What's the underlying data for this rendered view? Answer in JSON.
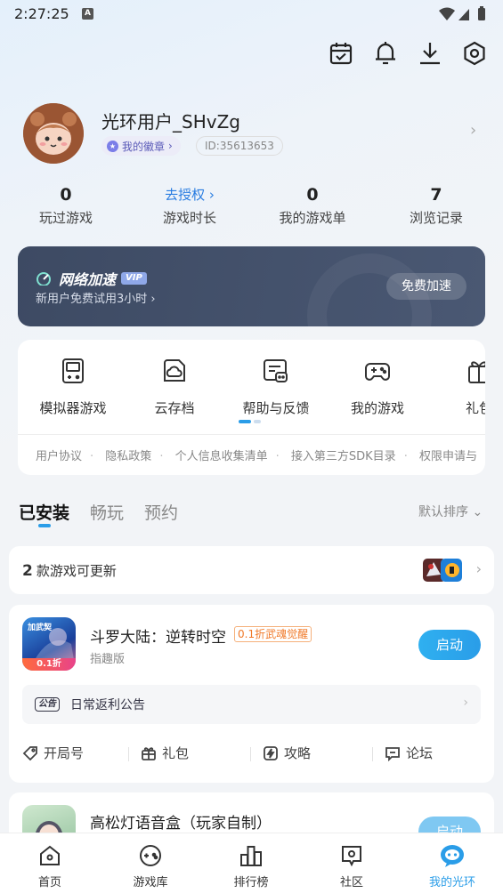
{
  "status_bar": {
    "time": "2:27:25",
    "a_icon": "A"
  },
  "top_actions": [
    {
      "icon": "calendar-check-icon"
    },
    {
      "icon": "bell-icon"
    },
    {
      "icon": "download-icon"
    },
    {
      "icon": "settings-hexagon-icon"
    }
  ],
  "profile": {
    "username": "光环用户_SHvZg",
    "badge_label": "我的徽章",
    "user_id": "ID:35613653"
  },
  "stats": [
    {
      "value": "0",
      "label": "玩过游戏"
    },
    {
      "value": "去授权",
      "label": "游戏时长"
    },
    {
      "value": "0",
      "label": "我的游戏单"
    },
    {
      "value": "7",
      "label": "浏览记录"
    }
  ],
  "accelerator": {
    "title": "网络加速",
    "vip": "VIP",
    "subtitle": "新用户免费试用3小时",
    "button": "免费加速"
  },
  "tools": [
    {
      "label": "模拟器游戏",
      "icon": "gameboy-icon"
    },
    {
      "label": "云存档",
      "icon": "cloud-save-icon"
    },
    {
      "label": "帮助与反馈",
      "icon": "help-feedback-icon"
    },
    {
      "label": "我的游戏",
      "icon": "gamepad-icon"
    },
    {
      "label": "礼包",
      "icon": "gift-icon"
    }
  ],
  "legal_links": [
    "用户协议",
    "隐私政策",
    "个人信息收集清单",
    "接入第三方SDK目录",
    "权限申请与"
  ],
  "game_tabs": [
    {
      "label": "已安装",
      "active": true
    },
    {
      "label": "畅玩",
      "active": false
    },
    {
      "label": "预约",
      "active": false
    }
  ],
  "sort_label": "默认排序",
  "updates": {
    "count": "2",
    "text": "款游戏可更新"
  },
  "game1": {
    "icon_tag": "加武契",
    "icon_discount": "0.1折",
    "name": "斗罗大陆：逆转时空",
    "tag": "0.1折武魂觉醒",
    "sub": "指趣版",
    "launch": "启动",
    "notice_badge": "公告",
    "notice": "日常返利公告",
    "actions": [
      {
        "label": "开局号",
        "icon": "tag-icon"
      },
      {
        "label": "礼包",
        "icon": "gift-icon"
      },
      {
        "label": "攻略",
        "icon": "strategy-icon"
      },
      {
        "label": "论坛",
        "icon": "forum-icon"
      }
    ]
  },
  "game2": {
    "name": "高松灯语音盒（玩家自制）",
    "launch": "启动"
  },
  "bottom_nav": [
    {
      "label": "首页",
      "icon": "home-icon"
    },
    {
      "label": "游戏库",
      "icon": "game-library-icon"
    },
    {
      "label": "排行榜",
      "icon": "ranking-icon"
    },
    {
      "label": "社区",
      "icon": "community-icon"
    },
    {
      "label": "我的光环",
      "icon": "my-halo-icon",
      "active": true
    }
  ],
  "colors": {
    "accent": "#2a9de8",
    "accel_card": "#3d4a63",
    "tag_orange": "#f07a2a"
  }
}
